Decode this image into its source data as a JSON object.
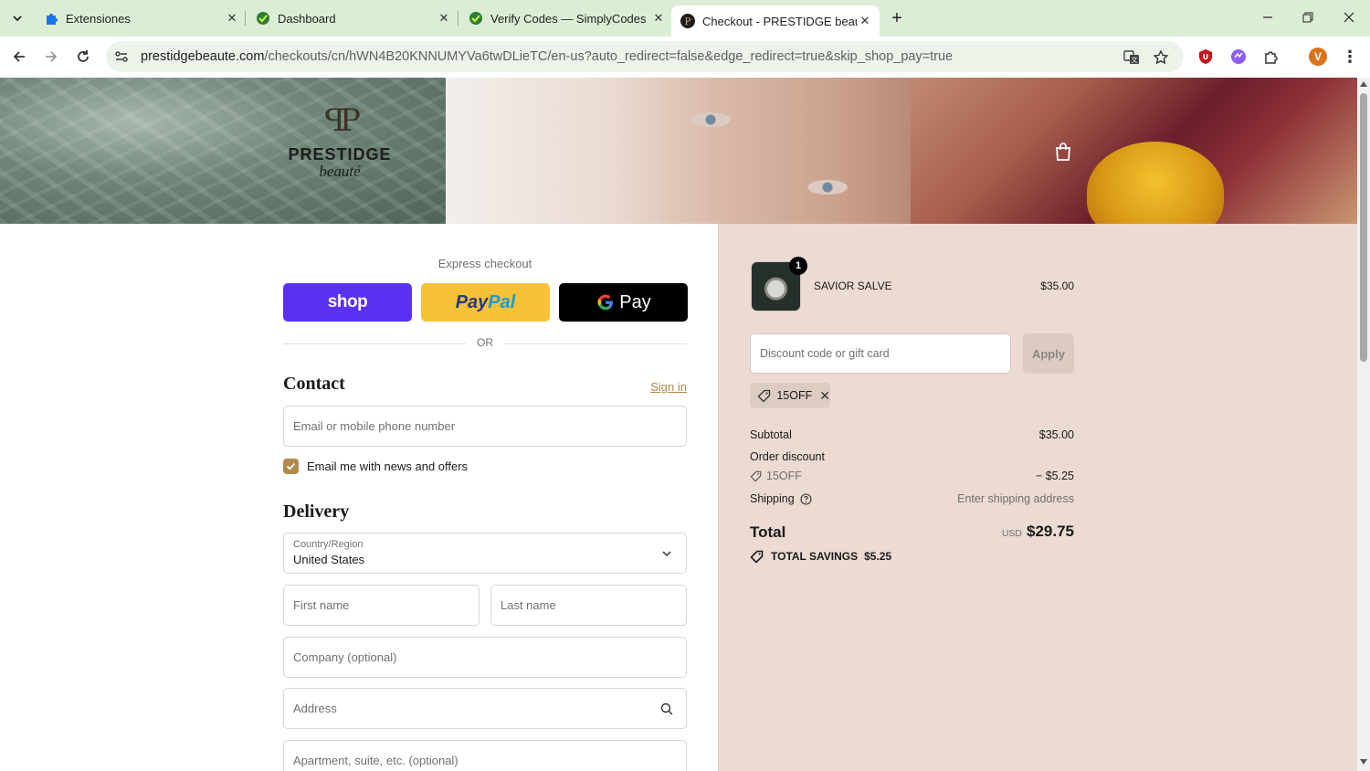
{
  "browser": {
    "tabs": [
      {
        "title": "Extensiones",
        "favicon": "puzzle-icon"
      },
      {
        "title": "Dashboard",
        "favicon": "simplycodes-icon"
      },
      {
        "title": "Verify Codes — SimplyCodes",
        "favicon": "simplycodes-icon"
      },
      {
        "title": "Checkout - PRESTIDGE beauté",
        "favicon": "prestidge-icon",
        "active": true
      }
    ],
    "url_host": "prestidgebeaute.com",
    "url_path": "/checkouts/cn/hWN4B20KNNUMYVa6twDLieTC/en-us?auto_redirect=false&edge_redirect=true&skip_shop_pay=true",
    "profile_initial": "V",
    "colors": {
      "tabbar": "#dcedd6",
      "accent": "#b3884f",
      "summary_bg": "#ecdbd3",
      "shop": "#5a31f4",
      "paypal": "#f7c138"
    }
  },
  "brand": {
    "name": "PRESTIDGE",
    "subtitle": "beauté"
  },
  "express": {
    "label": "Express checkout",
    "shop_label": "shop",
    "paypal_label_1": "Pay",
    "paypal_label_2": "Pal",
    "gpay_label": "Pay",
    "or_label": "OR"
  },
  "contact": {
    "title": "Contact",
    "sign_in": "Sign in",
    "email_placeholder": "Email or mobile phone number",
    "newsletter_label": "Email me with news and offers",
    "newsletter_checked": true
  },
  "delivery": {
    "title": "Delivery",
    "country_label": "Country/Region",
    "country_value": "United States",
    "first_name_placeholder": "First name",
    "last_name_placeholder": "Last name",
    "company_placeholder": "Company (optional)",
    "address_placeholder": "Address",
    "apartment_placeholder": "Apartment, suite, etc. (optional)"
  },
  "summary": {
    "item": {
      "quantity": "1",
      "name": "SAVIOR SALVE",
      "price": "$35.00"
    },
    "discount_placeholder": "Discount code or gift card",
    "apply_label": "Apply",
    "applied_code": "15OFF",
    "subtotal_label": "Subtotal",
    "subtotal_value": "$35.00",
    "order_discount_label": "Order discount",
    "discount_code": "15OFF",
    "discount_value": "− $5.25",
    "shipping_label": "Shipping",
    "shipping_value": "Enter shipping address",
    "total_label": "Total",
    "total_currency": "USD",
    "total_value": "$29.75",
    "savings_label": "TOTAL SAVINGS",
    "savings_value": "$5.25"
  }
}
